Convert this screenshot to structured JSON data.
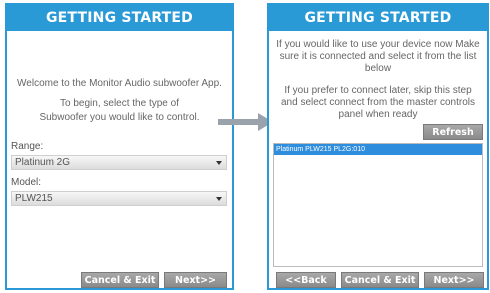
{
  "left": {
    "title": "GETTING STARTED",
    "welcome_line1": "Welcome to the Monitor Audio subwoofer App.",
    "welcome_line2": "To begin, select the type of Subwoofer you would like to control.",
    "range_label": "Range:",
    "range_value": "Platinum 2G",
    "model_label": "Model:",
    "model_value": "PLW215",
    "cancel_label": "Cancel & Exit",
    "next_label": "Next>>"
  },
  "right": {
    "title": "GETTING STARTED",
    "instruction1": "If you would like to use your device now Make sure it is connected and select it from the list below",
    "instruction2": "If you prefer to connect later, skip this step and select connect from the master controls panel when ready",
    "refresh_label": "Refresh",
    "devices": [
      "Platinum PLW215 PL2G:010"
    ],
    "back_label": "<<Back",
    "cancel_label": "Cancel & Exit",
    "next_label": "Next>>"
  },
  "colors": {
    "accent": "#2a9ad6",
    "button": "#999999",
    "arrow": "#9aa3ab",
    "selected_row": "#2f8ddd"
  },
  "icons": {
    "transition": "right-arrow-icon",
    "dropdown": "chevron-down-icon"
  }
}
